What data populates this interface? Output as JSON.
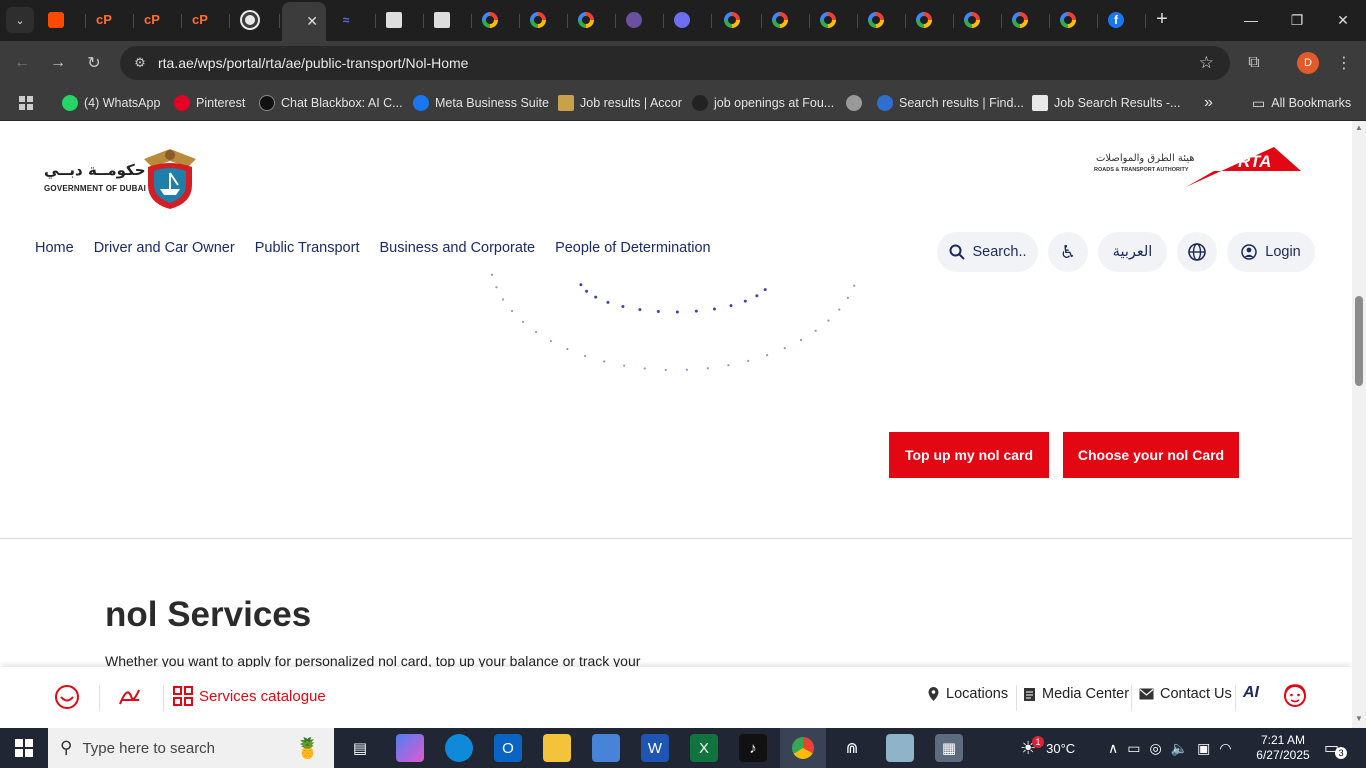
{
  "browser": {
    "active_tab_close": "✕",
    "new_tab": "+",
    "window_controls": {
      "minimize": "—",
      "maximize": "❐",
      "close": "✕"
    },
    "url": "rta.ae/wps/portal/rta/ae/public-transport/Nol-Home",
    "profile_initial": "D",
    "bookmarks": [
      {
        "label": "(4) WhatsApp",
        "icon": "whatsapp-icon",
        "color": "#25d366"
      },
      {
        "label": "Pinterest",
        "icon": "pinterest-icon",
        "color": "#e60023"
      },
      {
        "label": "Chat Blackbox: AI C...",
        "icon": "blackbox-icon",
        "color": "#111111"
      },
      {
        "label": "Meta Business Suite",
        "icon": "meta-icon",
        "color": "#1877f2"
      },
      {
        "label": "Job results | Accor",
        "icon": "accor-icon",
        "color": "#c8a24a"
      },
      {
        "label": "job openings at Fou...",
        "icon": "drop-icon",
        "color": "#222222"
      },
      {
        "label": "Search results | Find...",
        "icon": "search-result-icon",
        "color": "#2f6fd0"
      },
      {
        "label": "Job Search Results -...",
        "icon": "page-icon",
        "color": "#e8e8e8"
      }
    ],
    "bookmarks_more": "»",
    "all_bookmarks": "All Bookmarks"
  },
  "header": {
    "gov": {
      "arabic": "حكومــة دبــي",
      "english": "GOVERNMENT OF DUBAI"
    },
    "rta": {
      "arabic": "هيئة الطرق والمواصلات",
      "english": "ROADS & TRANSPORT AUTHORITY",
      "mark": "RTA"
    }
  },
  "nav": {
    "items": [
      "Home",
      "Driver and Car Owner",
      "Public Transport",
      "Business and Corporate",
      "People of Determination"
    ],
    "search_placeholder": "Search..",
    "arabic": "العربية",
    "login": "Login"
  },
  "hero": {
    "btn_topup": "Top up my nol card",
    "btn_choose": "Choose your nol Card"
  },
  "section": {
    "title": "nol Services",
    "description": "Whether you want to apply for personalized nol card, top up your balance or track your"
  },
  "bottom_bar": {
    "services": "Services catalogue",
    "locations": "Locations",
    "media": "Media Center",
    "contact": "Contact Us",
    "ai": "AI"
  },
  "taskbar": {
    "search_placeholder": "Type here to search",
    "weather": "30°C",
    "weather_badge": "1",
    "time": "7:21 AM",
    "date": "6/27/2025",
    "notifications": "3"
  },
  "colors": {
    "accent": "#e30613",
    "nav_text": "#1a2b6b",
    "dots": "#2d3fa8"
  }
}
